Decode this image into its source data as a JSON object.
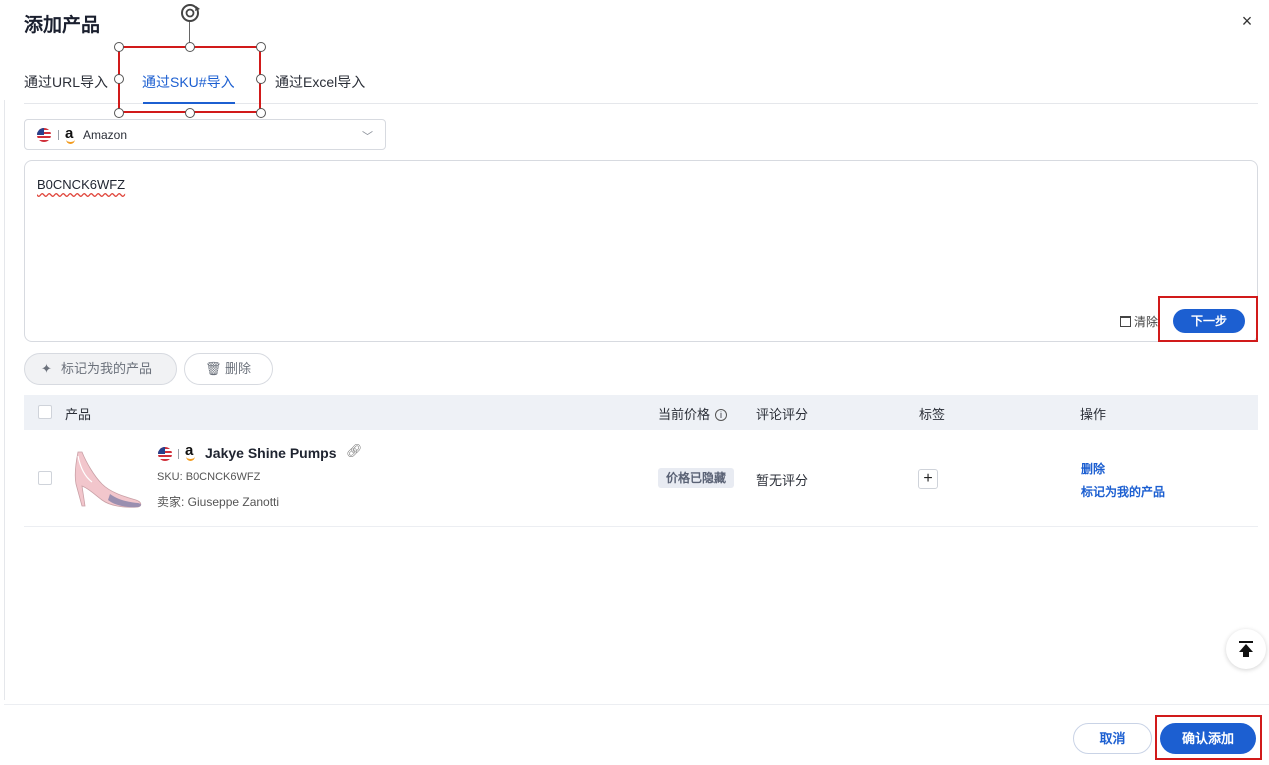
{
  "dialog": {
    "title": "添加产品",
    "close_icon": "×"
  },
  "tabs": [
    {
      "label": "通过URL导入"
    },
    {
      "label": "通过SKU#导入",
      "active": true
    },
    {
      "label": "通过Excel导入"
    }
  ],
  "marketplace": {
    "label": "Amazon",
    "logo_letter": "a",
    "flag": "us-flag-icon"
  },
  "sku_input": {
    "value": "B0CNCK6WFZ",
    "clear_label": "清除",
    "next_label": "下一步"
  },
  "bulk_actions": {
    "mark_mine": "标记为我的产品",
    "delete": "删除"
  },
  "table": {
    "columns": {
      "product": "产品",
      "price": "当前价格",
      "rating": "评论评分",
      "tags": "标签",
      "actions": "操作"
    },
    "rows": [
      {
        "name": "Jakye Shine Pumps",
        "sku": "SKU: B0CNCK6WFZ",
        "seller": "卖家: Giuseppe Zanotti",
        "price": "价格已隐藏",
        "rating": "暂无评分",
        "tag_add": "+",
        "action_delete": "删除",
        "action_mark": "标记为我的产品"
      }
    ]
  },
  "footer": {
    "cancel": "取消",
    "confirm": "确认添加"
  },
  "colors": {
    "accent": "#1c5fd1",
    "highlight": "#d11a1a"
  }
}
